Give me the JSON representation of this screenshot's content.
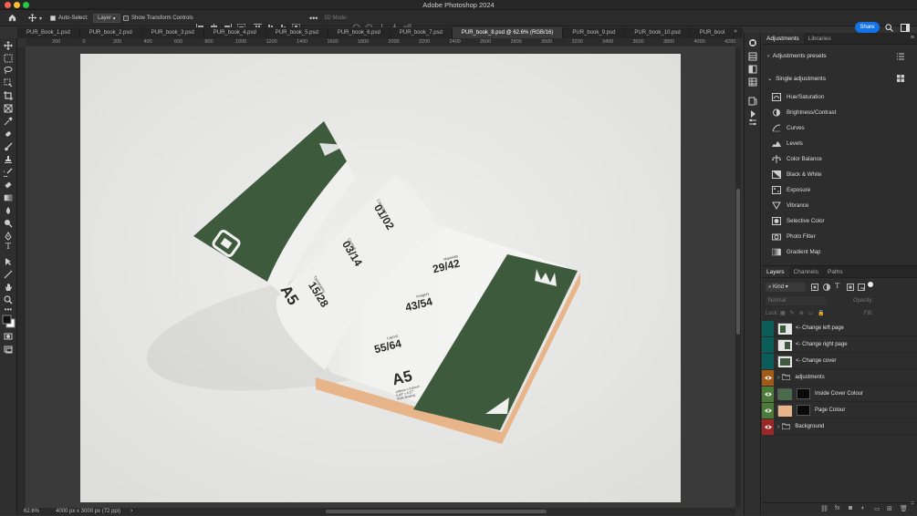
{
  "app": {
    "window_title": "Adobe Photoshop 2024",
    "share_label": "Share"
  },
  "colors": {
    "accent": "#1473e6",
    "book_green": "#3d5a3d",
    "page_peach": "#e8b48a",
    "layer_teal": "#0b5d5a",
    "layer_orange": "#a35a16",
    "layer_green": "#4c7a39",
    "layer_red": "#9d2626"
  },
  "options": {
    "auto_select_label": "Auto-Select:",
    "auto_select_value": "Layer",
    "transform_label": "Show Transform Controls",
    "mode_3d": "3D Mode:"
  },
  "tabs": [
    {
      "label": "PUR_Book_1.psd"
    },
    {
      "label": "PUR_book_2.psd"
    },
    {
      "label": "PUR_book_3.psd"
    },
    {
      "label": "PUR_book_4.psd"
    },
    {
      "label": "PUR_book_5.psd"
    },
    {
      "label": "PUR_book_6.psd"
    },
    {
      "label": "PUR_book_7.psd"
    },
    {
      "label": "PUR_book_8.psd @ 62.6% (RGB/16)"
    },
    {
      "label": "PUR_book_9.psd"
    },
    {
      "label": "PUR_book_10.psd"
    },
    {
      "label": "PUR_bool"
    }
  ],
  "ruler": [
    "200",
    "0",
    "200",
    "400",
    "600",
    "800",
    "1000",
    "1200",
    "1400",
    "1600",
    "1800",
    "2000",
    "2200",
    "2400",
    "2600",
    "2800",
    "3000",
    "3200",
    "3400",
    "3600",
    "3800",
    "4000",
    "4200"
  ],
  "status": {
    "zoom": "62.6%",
    "doc_info": "4000 px x 3000 px (72 ppi)"
  },
  "book": {
    "left_page": [
      "01/02",
      "03/14",
      "15/28"
    ],
    "left_small": [
      "Catalogue",
      "Content",
      "Typography"
    ],
    "right_page": [
      "29/42",
      "43/54",
      "55/64"
    ],
    "right_small": [
      "Materials",
      "Imagery",
      "Layout"
    ],
    "size_label": "A5",
    "size_note": "148mm x 210mm\n5.83\" x 8.27\"\nPUR Binding"
  },
  "adjustments": {
    "tab_adjustments": "Adjustments",
    "tab_libraries": "Libraries",
    "presets_label": "Adjustments presets",
    "single_label": "Single adjustments",
    "items": [
      {
        "label": "Hue/Saturation",
        "icon": "hue-saturation-icon"
      },
      {
        "label": "Brightness/Contrast",
        "icon": "brightness-contrast-icon"
      },
      {
        "label": "Curves",
        "icon": "curves-icon"
      },
      {
        "label": "Levels",
        "icon": "levels-icon"
      },
      {
        "label": "Color Balance",
        "icon": "color-balance-icon"
      },
      {
        "label": "Black & White",
        "icon": "black-white-icon"
      },
      {
        "label": "Exposure",
        "icon": "exposure-icon"
      },
      {
        "label": "Vibrance",
        "icon": "vibrance-icon"
      },
      {
        "label": "Selective Color",
        "icon": "selective-color-icon"
      },
      {
        "label": "Photo Filter",
        "icon": "photo-filter-icon"
      },
      {
        "label": "Gradient Map",
        "icon": "gradient-map-icon"
      }
    ]
  },
  "layers": {
    "tab_layers": "Layers",
    "tab_channels": "Channels",
    "tab_paths": "Paths",
    "kind_label": "Kind",
    "blend_mode": "Normal",
    "opacity_label": "Opacity:",
    "lock_label": "Lock:",
    "fill_label": "Fill:",
    "rows": [
      {
        "name": "<- Change left page",
        "eye_color": "#0b5d5a",
        "visible": false
      },
      {
        "name": "<- Change right page",
        "eye_color": "#0b5d5a",
        "visible": false
      },
      {
        "name": "<- Change cover",
        "eye_color": "#0b5d5a",
        "visible": false
      },
      {
        "name": "adjustments",
        "eye_color": "#a35a16",
        "visible": true
      },
      {
        "name": "Inside Cover Colour",
        "eye_color": "#4c7a39",
        "visible": true
      },
      {
        "name": "Page Colour",
        "eye_color": "#4c7a39",
        "visible": true
      },
      {
        "name": "Background",
        "eye_color": "#9d2626",
        "visible": true
      }
    ]
  }
}
